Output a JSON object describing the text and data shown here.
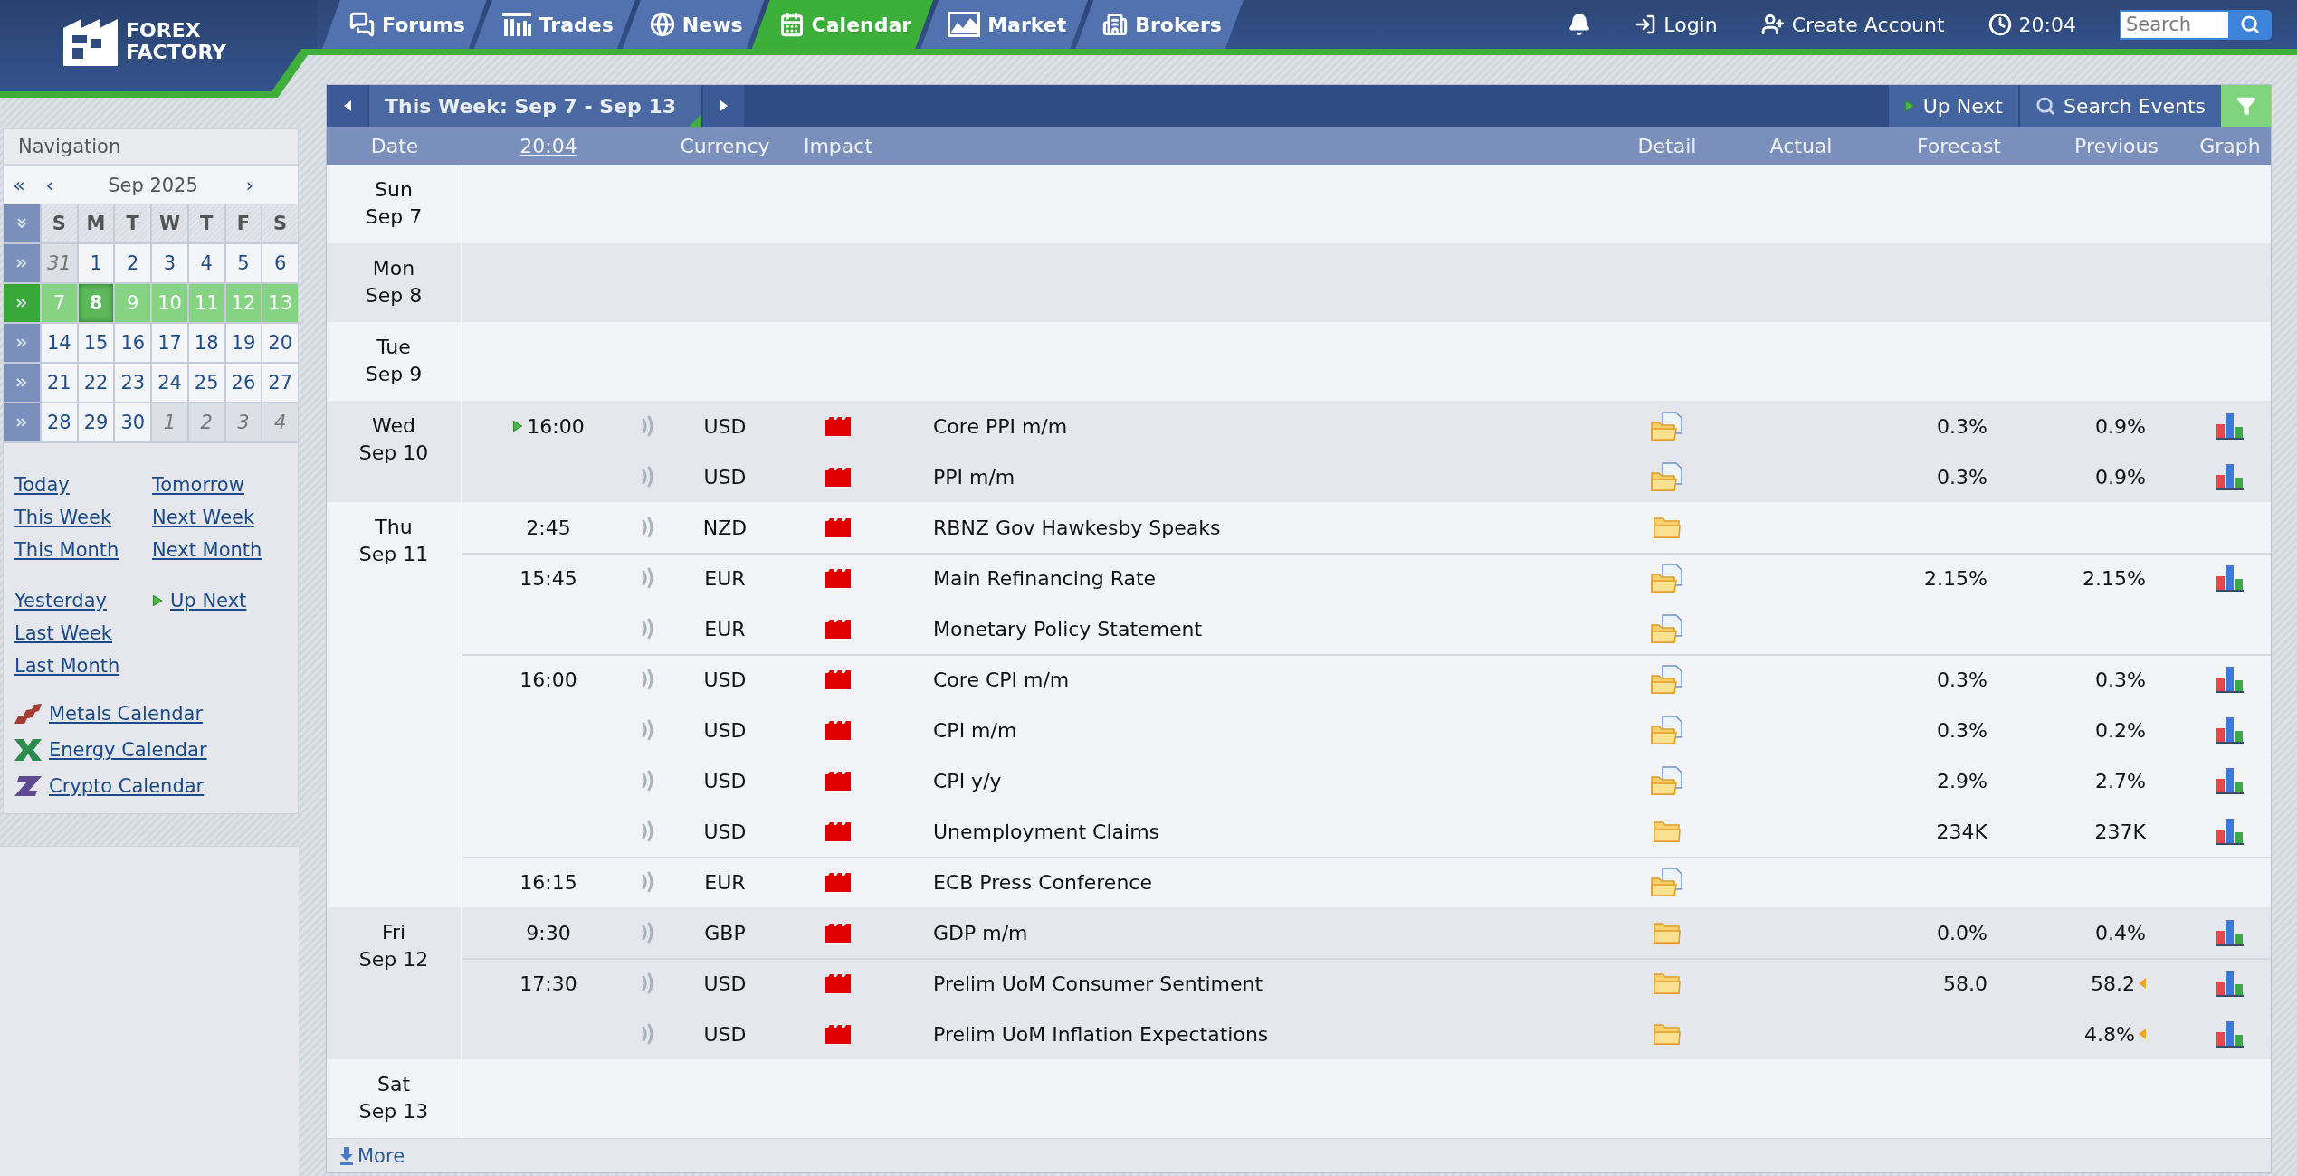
{
  "header": {
    "logo": [
      "FOREX",
      "FACTORY"
    ],
    "tabs": [
      {
        "label": "Forums",
        "kind": "forums",
        "selected": false
      },
      {
        "label": "Trades",
        "kind": "trades",
        "selected": false
      },
      {
        "label": "News",
        "kind": "news",
        "selected": false
      },
      {
        "label": "Calendar",
        "kind": "calendar",
        "selected": true
      },
      {
        "label": "Market",
        "kind": "market",
        "selected": false
      },
      {
        "label": "Brokers",
        "kind": "brokers",
        "selected": false
      }
    ],
    "login": "Login",
    "create_account": "Create Account",
    "time": "20:04",
    "search": {
      "placeholder": "Search"
    }
  },
  "sidebar": {
    "title": "Navigation",
    "month_nav": {
      "first": "«",
      "prev": "‹",
      "label": "Sep 2025",
      "next": "›"
    },
    "weekdays": [
      "S",
      "M",
      "T",
      "W",
      "T",
      "F",
      "S"
    ],
    "weeks": [
      {
        "selected": false,
        "days": [
          {
            "label": "31",
            "muted": true,
            "today": false
          },
          {
            "label": "1",
            "muted": false,
            "today": false
          },
          {
            "label": "2",
            "muted": false,
            "today": false
          },
          {
            "label": "3",
            "muted": false,
            "today": false
          },
          {
            "label": "4",
            "muted": false,
            "today": false
          },
          {
            "label": "5",
            "muted": false,
            "today": false
          },
          {
            "label": "6",
            "muted": false,
            "today": false
          }
        ]
      },
      {
        "selected": true,
        "days": [
          {
            "label": "7",
            "muted": false,
            "today": false
          },
          {
            "label": "8",
            "muted": false,
            "today": true
          },
          {
            "label": "9",
            "muted": false,
            "today": false
          },
          {
            "label": "10",
            "muted": false,
            "today": false
          },
          {
            "label": "11",
            "muted": false,
            "today": false
          },
          {
            "label": "12",
            "muted": false,
            "today": false
          },
          {
            "label": "13",
            "muted": false,
            "today": false
          }
        ]
      },
      {
        "selected": false,
        "days": [
          {
            "label": "14",
            "muted": false,
            "today": false
          },
          {
            "label": "15",
            "muted": false,
            "today": false
          },
          {
            "label": "16",
            "muted": false,
            "today": false
          },
          {
            "label": "17",
            "muted": false,
            "today": false
          },
          {
            "label": "18",
            "muted": false,
            "today": false
          },
          {
            "label": "19",
            "muted": false,
            "today": false
          },
          {
            "label": "20",
            "muted": false,
            "today": false
          }
        ]
      },
      {
        "selected": false,
        "days": [
          {
            "label": "21",
            "muted": false,
            "today": false
          },
          {
            "label": "22",
            "muted": false,
            "today": false
          },
          {
            "label": "23",
            "muted": false,
            "today": false
          },
          {
            "label": "24",
            "muted": false,
            "today": false
          },
          {
            "label": "25",
            "muted": false,
            "today": false
          },
          {
            "label": "26",
            "muted": false,
            "today": false
          },
          {
            "label": "27",
            "muted": false,
            "today": false
          }
        ]
      },
      {
        "selected": false,
        "days": [
          {
            "label": "28",
            "muted": false,
            "today": false
          },
          {
            "label": "29",
            "muted": false,
            "today": false
          },
          {
            "label": "30",
            "muted": false,
            "today": false
          },
          {
            "label": "1",
            "muted": true,
            "today": false
          },
          {
            "label": "2",
            "muted": true,
            "today": false
          },
          {
            "label": "3",
            "muted": true,
            "today": false
          },
          {
            "label": "4",
            "muted": true,
            "today": false
          }
        ]
      }
    ],
    "link_groups": [
      {
        "rows": [
          [
            {
              "label": "Today",
              "kind": "plain"
            },
            {
              "label": "Tomorrow",
              "kind": "plain"
            }
          ],
          [
            {
              "label": "This Week",
              "kind": "plain"
            },
            {
              "label": "Next Week",
              "kind": "plain"
            }
          ],
          [
            {
              "label": "This Month",
              "kind": "plain"
            },
            {
              "label": "Next Month",
              "kind": "plain"
            }
          ]
        ]
      },
      {
        "rows": [
          [
            {
              "label": "Yesterday",
              "kind": "plain"
            },
            {
              "label": "Up Next",
              "kind": "up_next"
            }
          ],
          [
            {
              "label": "Last Week",
              "kind": "plain"
            }
          ],
          [
            {
              "label": "Last Month",
              "kind": "plain"
            }
          ]
        ]
      }
    ],
    "calendars": [
      {
        "label": "Metals Calendar",
        "kind": "metals"
      },
      {
        "label": "Energy Calendar",
        "kind": "energy"
      },
      {
        "label": "Crypto Calendar",
        "kind": "crypto"
      }
    ]
  },
  "calendar": {
    "title": "This Week: Sep 7 - Sep 13",
    "up_next": "Up Next",
    "search_events": "Search Events",
    "columns": [
      {
        "label": "Date",
        "kind": "text"
      },
      {
        "label": "20:04",
        "kind": "link"
      },
      {
        "label": "Currency",
        "kind": "text"
      },
      {
        "label": "Impact",
        "kind": "text"
      },
      {
        "label": "Detail",
        "kind": "text"
      },
      {
        "label": "Actual",
        "kind": "text"
      },
      {
        "label": "Forecast",
        "kind": "text"
      },
      {
        "label": "Previous",
        "kind": "text"
      },
      {
        "label": "Graph",
        "kind": "text"
      }
    ],
    "days": [
      {
        "day": "Sun",
        "date": "Sep 7"
      },
      {
        "day": "Mon",
        "date": "Sep 8"
      },
      {
        "day": "Tue",
        "date": "Sep 9"
      },
      {
        "day": "Wed",
        "date": "Sep 10",
        "groups": [
          {
            "time": "16:00",
            "up_next": true,
            "events": [
              {
                "currency": "USD",
                "impact": {
                  "kind": "high"
                },
                "title": "Core PPI m/m",
                "detail": {
                  "kind": "document"
                },
                "forecast": "0.3%",
                "previous": "0.9%",
                "revised": false,
                "graph": true
              },
              {
                "currency": "USD",
                "impact": {
                  "kind": "high"
                },
                "title": "PPI m/m",
                "detail": {
                  "kind": "document"
                },
                "forecast": "0.3%",
                "previous": "0.9%",
                "revised": false,
                "graph": true
              }
            ]
          }
        ]
      },
      {
        "day": "Thu",
        "date": "Sep 11",
        "groups": [
          {
            "time": "2:45",
            "up_next": false,
            "events": [
              {
                "currency": "NZD",
                "impact": {
                  "kind": "high"
                },
                "title": "RBNZ Gov Hawkesby Speaks",
                "detail": {
                  "kind": "folder"
                },
                "revised": false,
                "graph": false
              }
            ]
          },
          {
            "time": "15:45",
            "up_next": false,
            "events": [
              {
                "currency": "EUR",
                "impact": {
                  "kind": "high"
                },
                "title": "Main Refinancing Rate",
                "detail": {
                  "kind": "document"
                },
                "forecast": "2.15%",
                "previous": "2.15%",
                "revised": false,
                "graph": true
              },
              {
                "currency": "EUR",
                "impact": {
                  "kind": "high"
                },
                "title": "Monetary Policy Statement",
                "detail": {
                  "kind": "document"
                },
                "revised": false,
                "graph": false
              }
            ]
          },
          {
            "time": "16:00",
            "up_next": false,
            "events": [
              {
                "currency": "USD",
                "impact": {
                  "kind": "high"
                },
                "title": "Core CPI m/m",
                "detail": {
                  "kind": "document"
                },
                "forecast": "0.3%",
                "previous": "0.3%",
                "revised": false,
                "graph": true
              },
              {
                "currency": "USD",
                "impact": {
                  "kind": "high"
                },
                "title": "CPI m/m",
                "detail": {
                  "kind": "document"
                },
                "forecast": "0.3%",
                "previous": "0.2%",
                "revised": false,
                "graph": true
              },
              {
                "currency": "USD",
                "impact": {
                  "kind": "high"
                },
                "title": "CPI y/y",
                "detail": {
                  "kind": "document"
                },
                "forecast": "2.9%",
                "previous": "2.7%",
                "revised": false,
                "graph": true
              },
              {
                "currency": "USD",
                "impact": {
                  "kind": "high"
                },
                "title": "Unemployment Claims",
                "detail": {
                  "kind": "folder"
                },
                "forecast": "234K",
                "previous": "237K",
                "revised": false,
                "graph": true
              }
            ]
          },
          {
            "time": "16:15",
            "up_next": false,
            "events": [
              {
                "currency": "EUR",
                "impact": {
                  "kind": "high"
                },
                "title": "ECB Press Conference",
                "detail": {
                  "kind": "document"
                },
                "revised": false,
                "graph": false
              }
            ]
          }
        ]
      },
      {
        "day": "Fri",
        "date": "Sep 12",
        "groups": [
          {
            "time": "9:30",
            "up_next": false,
            "events": [
              {
                "currency": "GBP",
                "impact": {
                  "kind": "high"
                },
                "title": "GDP m/m",
                "detail": {
                  "kind": "folder"
                },
                "forecast": "0.0%",
                "previous": "0.4%",
                "revised": false,
                "graph": true
              }
            ]
          },
          {
            "time": "17:30",
            "up_next": false,
            "events": [
              {
                "currency": "USD",
                "impact": {
                  "kind": "high"
                },
                "title": "Prelim UoM Consumer Sentiment",
                "detail": {
                  "kind": "folder"
                },
                "forecast": "58.0",
                "previous": "58.2",
                "revised": true,
                "graph": true
              },
              {
                "currency": "USD",
                "impact": {
                  "kind": "high"
                },
                "title": "Prelim UoM Inflation Expectations",
                "detail": {
                  "kind": "folder"
                },
                "previous": "4.8%",
                "revised": true,
                "graph": true
              }
            ]
          }
        ]
      },
      {
        "day": "Sat",
        "date": "Sep 13"
      }
    ],
    "more": "More"
  }
}
